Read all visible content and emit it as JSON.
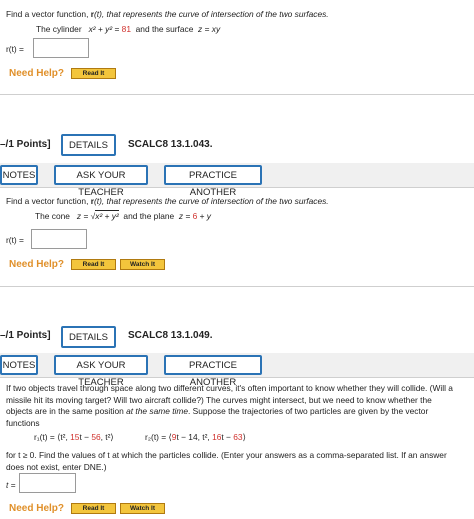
{
  "q1": {
    "prompt_a": "Find a vector function, ",
    "prompt_r": "r",
    "prompt_b": "(t), that represents the curve of intersection of the two surfaces.",
    "cyl_lead": "The cylinder",
    "cyl_eq_lhs": "x² + y² = ",
    "cyl_value": "81",
    "cyl_and": "and the surface",
    "surface_eq": "z = xy",
    "answer_label": "r(t) =",
    "need_help": "Need Help?",
    "read_it": "Read It"
  },
  "q2": {
    "points": "–/1 Points]",
    "details": "DETAILS",
    "code": "SCALC8 13.1.043.",
    "tabs": [
      "NOTES",
      "ASK YOUR TEACHER",
      "PRACTICE ANOTHER"
    ],
    "prompt_a": "Find a vector function, ",
    "prompt_r": "r",
    "prompt_b": "(t), that represents the curve of intersection of the two surfaces.",
    "cone_lead": "The cone",
    "cone_eq": "z = ",
    "cone_root": "x² + y²",
    "plane_and": "and the plane",
    "plane_eq_a": "z = ",
    "plane_value": "6",
    "plane_eq_b": " + y",
    "answer_label": "r(t) =",
    "need_help": "Need Help?",
    "read_it": "Read It",
    "watch_it": "Watch It"
  },
  "q3": {
    "points": "–/1 Points]",
    "details": "DETAILS",
    "code": "SCALC8 13.1.049.",
    "tabs": [
      "NOTES",
      "ASK YOUR TEACHER",
      "PRACTICE ANOTHER"
    ],
    "para_l1": "If two objects travel through space along two different curves, it's often important to know whether they will collide. (Will a",
    "para_l2": "missile hit its moving target? Will two aircraft collide?) The curves might intersect, but we need to know whether the",
    "para_l3a": "objects are in the same position ",
    "para_l3b": "at the same time",
    "para_l3c": ". Suppose the trajectories of two particles are given by the vector",
    "para_l4": "functions",
    "r1_lhs": "r₁(t) = ⟨t², ",
    "r1_c1": "15",
    "r1_mid": "t − ",
    "r1_c2": "56",
    "r1_rhs": ", t²⟩",
    "r2_lhs": "r₂(t) = ⟨",
    "r2_c1": "9",
    "r2_mid": "t − 14, t², ",
    "r2_c2": "16",
    "r2_mid2": "t − ",
    "r2_c3": "63",
    "r2_rhs": "⟩",
    "task_l1": "for t ≥ 0.  Find the values of t at which the particles collide. (Enter your answers as a comma-separated list. If an answer",
    "task_l2": "does not exist, enter DNE.)",
    "answer_label": "t =",
    "need_help": "Need Help?",
    "read_it": "Read It",
    "watch_it": "Watch It"
  }
}
